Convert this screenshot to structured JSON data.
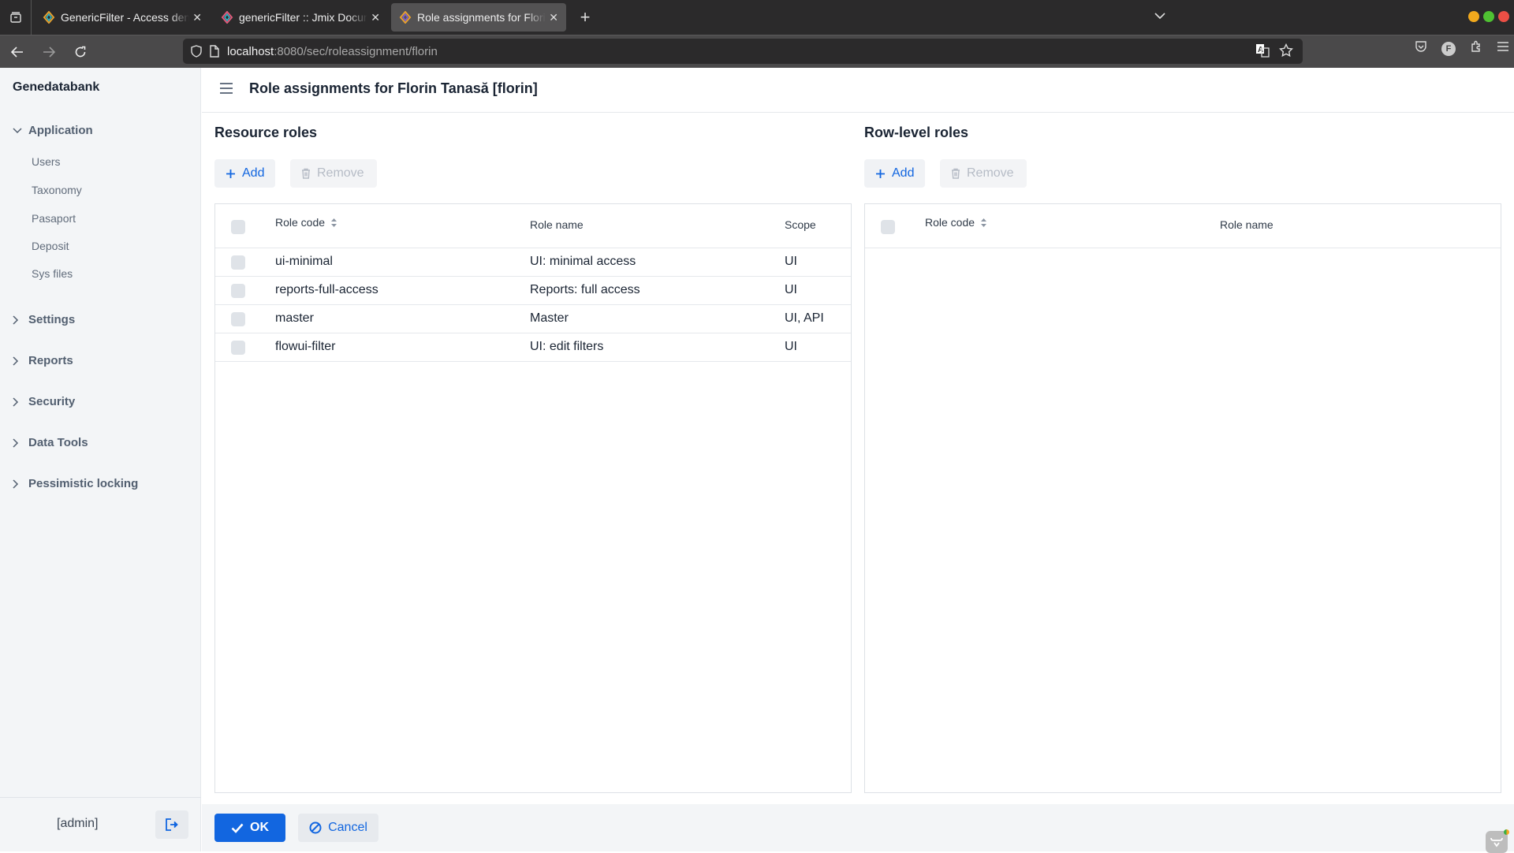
{
  "browser": {
    "tabs": [
      {
        "title": "GenericFilter - Access denied",
        "active": false
      },
      {
        "title": "genericFilter :: Jmix Documentation",
        "active": false
      },
      {
        "title": "Role assignments for Florin Tanasă",
        "active": true
      }
    ],
    "url_host": "localhost",
    "url_path": ":8080/sec/roleassignment/florin",
    "window_dot_colors": [
      "#f2a91d",
      "#4fc132",
      "#eb4f45"
    ],
    "profile_initial": "F"
  },
  "app": {
    "brand": "Genedatabank",
    "accent_color": "#1266e0",
    "sidebar": {
      "groups": [
        {
          "label": "Application",
          "expanded": true,
          "items": [
            "Users",
            "Taxonomy",
            "Pasaport",
            "Deposit",
            "Sys files"
          ]
        },
        {
          "label": "Settings",
          "expanded": false
        },
        {
          "label": "Reports",
          "expanded": false
        },
        {
          "label": "Security",
          "expanded": false
        },
        {
          "label": "Data Tools",
          "expanded": false
        },
        {
          "label": "Pessimistic locking",
          "expanded": false
        }
      ],
      "user": "[admin]"
    },
    "page_title": "Role assignments for Florin Tanasă [florin]",
    "resource_roles": {
      "title": "Resource roles",
      "add_label": "Add",
      "remove_label": "Remove",
      "columns": [
        "Role code",
        "Role name",
        "Scope"
      ],
      "rows": [
        {
          "code": "ui-minimal",
          "name": "UI: minimal access",
          "scope": "UI"
        },
        {
          "code": "reports-full-access",
          "name": "Reports: full access",
          "scope": "UI"
        },
        {
          "code": "master",
          "name": "Master",
          "scope": "UI, API"
        },
        {
          "code": "flowui-filter",
          "name": "UI: edit filters",
          "scope": "UI"
        }
      ]
    },
    "row_level_roles": {
      "title": "Row-level roles",
      "add_label": "Add",
      "remove_label": "Remove",
      "columns": [
        "Role code",
        "Role name"
      ],
      "rows": []
    },
    "footer": {
      "ok_label": "OK",
      "cancel_label": "Cancel"
    }
  }
}
